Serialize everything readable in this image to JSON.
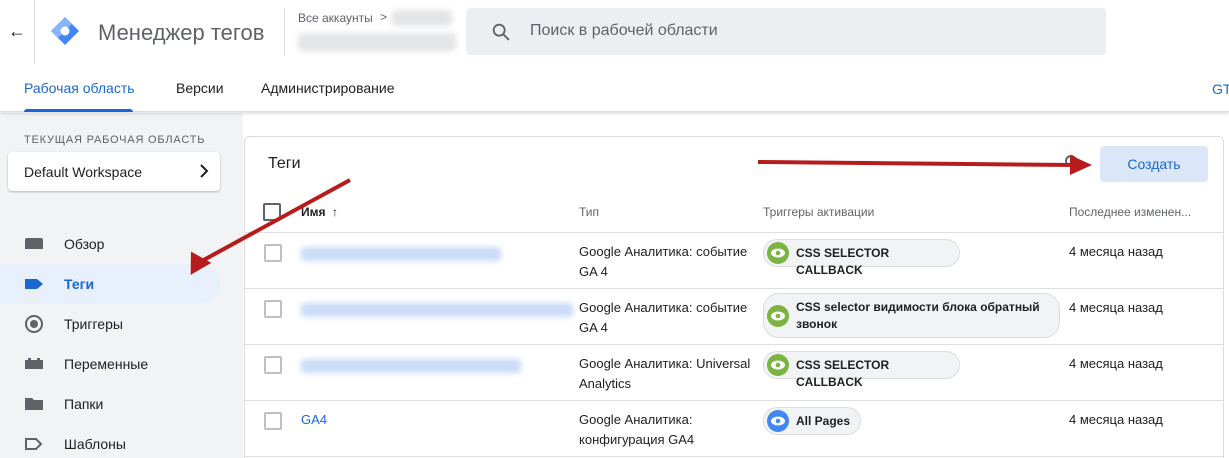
{
  "header": {
    "app_name": "Менеджер тегов",
    "accounts_label": "Все аккаунты",
    "accounts_chevron": ">",
    "search_placeholder": "Поиск в рабочей области"
  },
  "tabs": [
    {
      "label": "Рабочая область",
      "active": true
    },
    {
      "label": "Версии",
      "active": false
    },
    {
      "label": "Администрирование",
      "active": false
    }
  ],
  "tabs_right_text": "GT",
  "sidebar": {
    "workspace_label": "ТЕКУЩАЯ РАБОЧАЯ ОБЛАСТЬ",
    "workspace_name": "Default Workspace",
    "items": [
      {
        "label": "Обзор",
        "icon": "overview-icon",
        "active": false
      },
      {
        "label": "Теги",
        "icon": "tag-icon",
        "active": true
      },
      {
        "label": "Триггеры",
        "icon": "trigger-icon",
        "active": false
      },
      {
        "label": "Переменные",
        "icon": "variables-icon",
        "active": false
      },
      {
        "label": "Папки",
        "icon": "folder-icon",
        "active": false
      },
      {
        "label": "Шаблоны",
        "icon": "template-icon",
        "active": false
      }
    ]
  },
  "main": {
    "title": "Теги",
    "create_button": "Создать",
    "columns": {
      "name": "Имя",
      "sort_arrow": "↑",
      "type": "Тип",
      "triggers": "Триггеры активации",
      "modified": "Последнее изменен..."
    },
    "rows": [
      {
        "name": "",
        "type_line1": "Google Аналитика: событие",
        "type_line2": "GA 4",
        "trigger_line1": "CSS SELECTOR CALLBACK",
        "trigger_line2": "",
        "trigger_color": "#7cb342",
        "modified": "4 месяца назад"
      },
      {
        "name": "",
        "type_line1": "Google Аналитика: событие",
        "type_line2": "GA 4",
        "trigger_line1": "CSS selector видимости блока обратный",
        "trigger_line2": "звонок",
        "trigger_color": "#7cb342",
        "modified": "4 месяца назад"
      },
      {
        "name": "",
        "type_line1": "Google Аналитика: Universal",
        "type_line2": "Analytics",
        "trigger_line1": "CSS SELECTOR CALLBACK",
        "trigger_line2": "",
        "trigger_color": "#7cb342",
        "modified": "4 месяца назад"
      },
      {
        "name": "GA4",
        "type_line1": "Google Аналитика:",
        "type_line2": "конфигурация GA4",
        "trigger_line1": "All Pages",
        "trigger_line2": "",
        "trigger_color": "#4285f4",
        "modified": "4 месяца назад"
      }
    ]
  },
  "colors": {
    "accent": "#1967d2",
    "annotation_arrow": "#b71c1c"
  }
}
